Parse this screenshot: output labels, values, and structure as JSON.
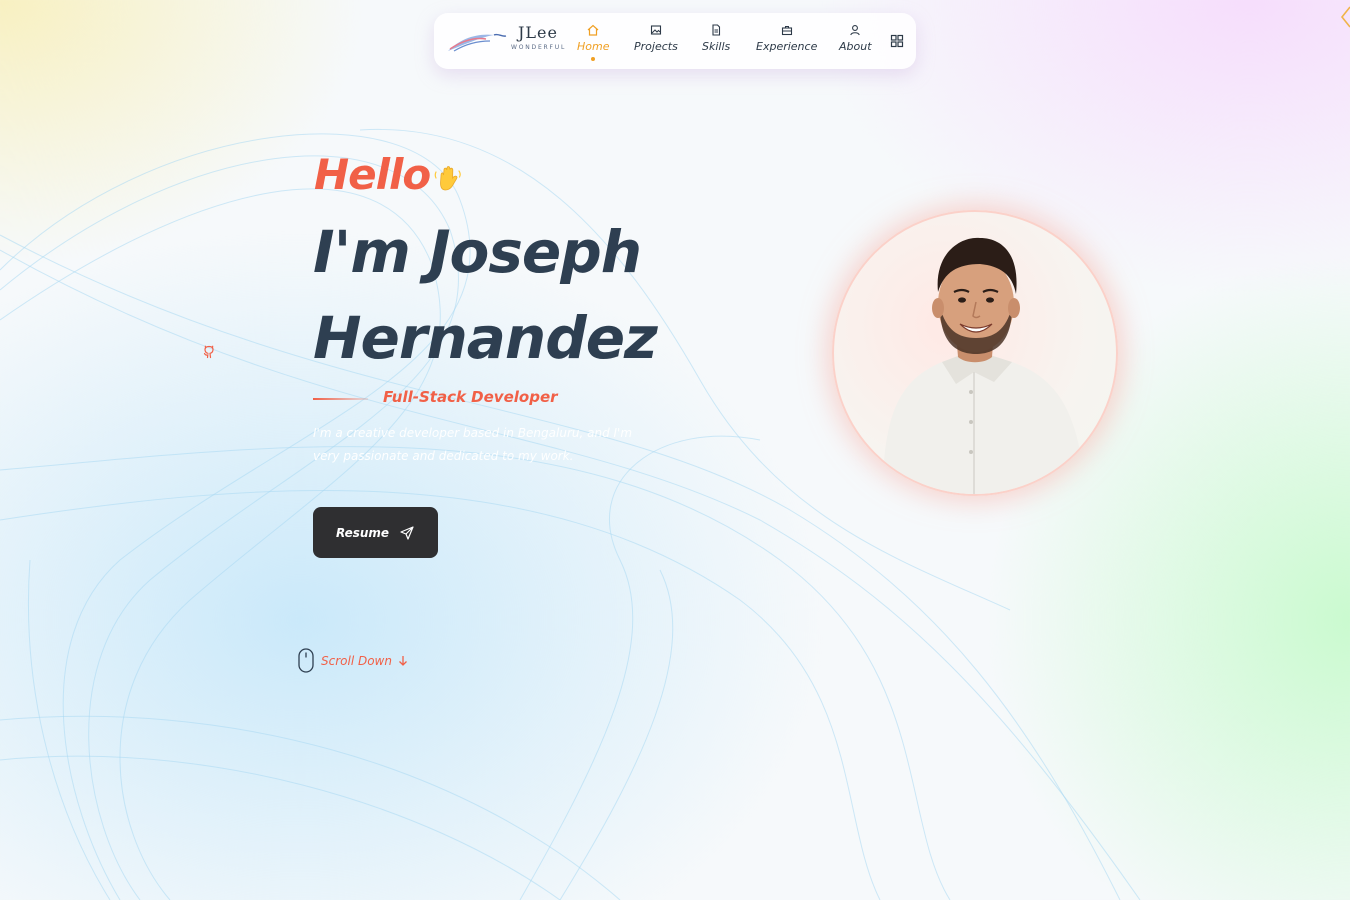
{
  "logo": {
    "title": "JLee",
    "subtitle": "WONDERFUL"
  },
  "nav": {
    "items": [
      {
        "label": "Home",
        "icon": "home-icon",
        "active": true
      },
      {
        "label": "Projects",
        "icon": "image-icon",
        "active": false
      },
      {
        "label": "Skills",
        "icon": "document-icon",
        "active": false
      },
      {
        "label": "Experience",
        "icon": "briefcase-icon",
        "active": false
      },
      {
        "label": "About",
        "icon": "user-icon",
        "active": false
      }
    ],
    "menu_icon": "grid-icon"
  },
  "hero": {
    "greeting": "Hello",
    "greeting_icon": "waving-hand-icon",
    "name_line1": "I'm Joseph",
    "name_line2": "Hernandez",
    "role": "Full-Stack Developer",
    "description": "I'm a creative developer based in Bengaluru, and I'm very passionate and dedicated to my work.",
    "resume_label": "Resume",
    "resume_icon": "send-icon",
    "scroll_label": "Scroll Down"
  },
  "social": {
    "github_icon": "github-icon"
  },
  "colors": {
    "accent": "#f16047",
    "nav_active": "#f0a024",
    "heading": "#2e3f51",
    "button": "#2f2f31"
  }
}
